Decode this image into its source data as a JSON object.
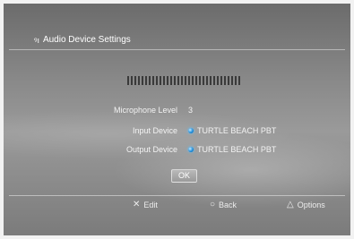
{
  "header": {
    "icon": "speaker-icon",
    "title": "Audio Device Settings"
  },
  "meter": {
    "icon": "level-meter"
  },
  "settings": [
    {
      "label": "Microphone Level",
      "value": "3"
    },
    {
      "label": "Input Device",
      "value": "TURTLE BEACH PBT",
      "selected": true
    },
    {
      "label": "Output Device",
      "value": "TURTLE BEACH PBT",
      "selected": true
    }
  ],
  "ok_button": {
    "label": "OK"
  },
  "footer": {
    "edit": {
      "icon": "cross-icon",
      "glyph": "✕",
      "label": "Edit"
    },
    "back": {
      "icon": "circle-icon",
      "glyph": "○",
      "label": "Back"
    },
    "options": {
      "icon": "triangle-icon",
      "glyph": "△",
      "label": "Options"
    }
  },
  "colors": {
    "accent": "#1a8ad8",
    "text": "#f3f3f3"
  }
}
